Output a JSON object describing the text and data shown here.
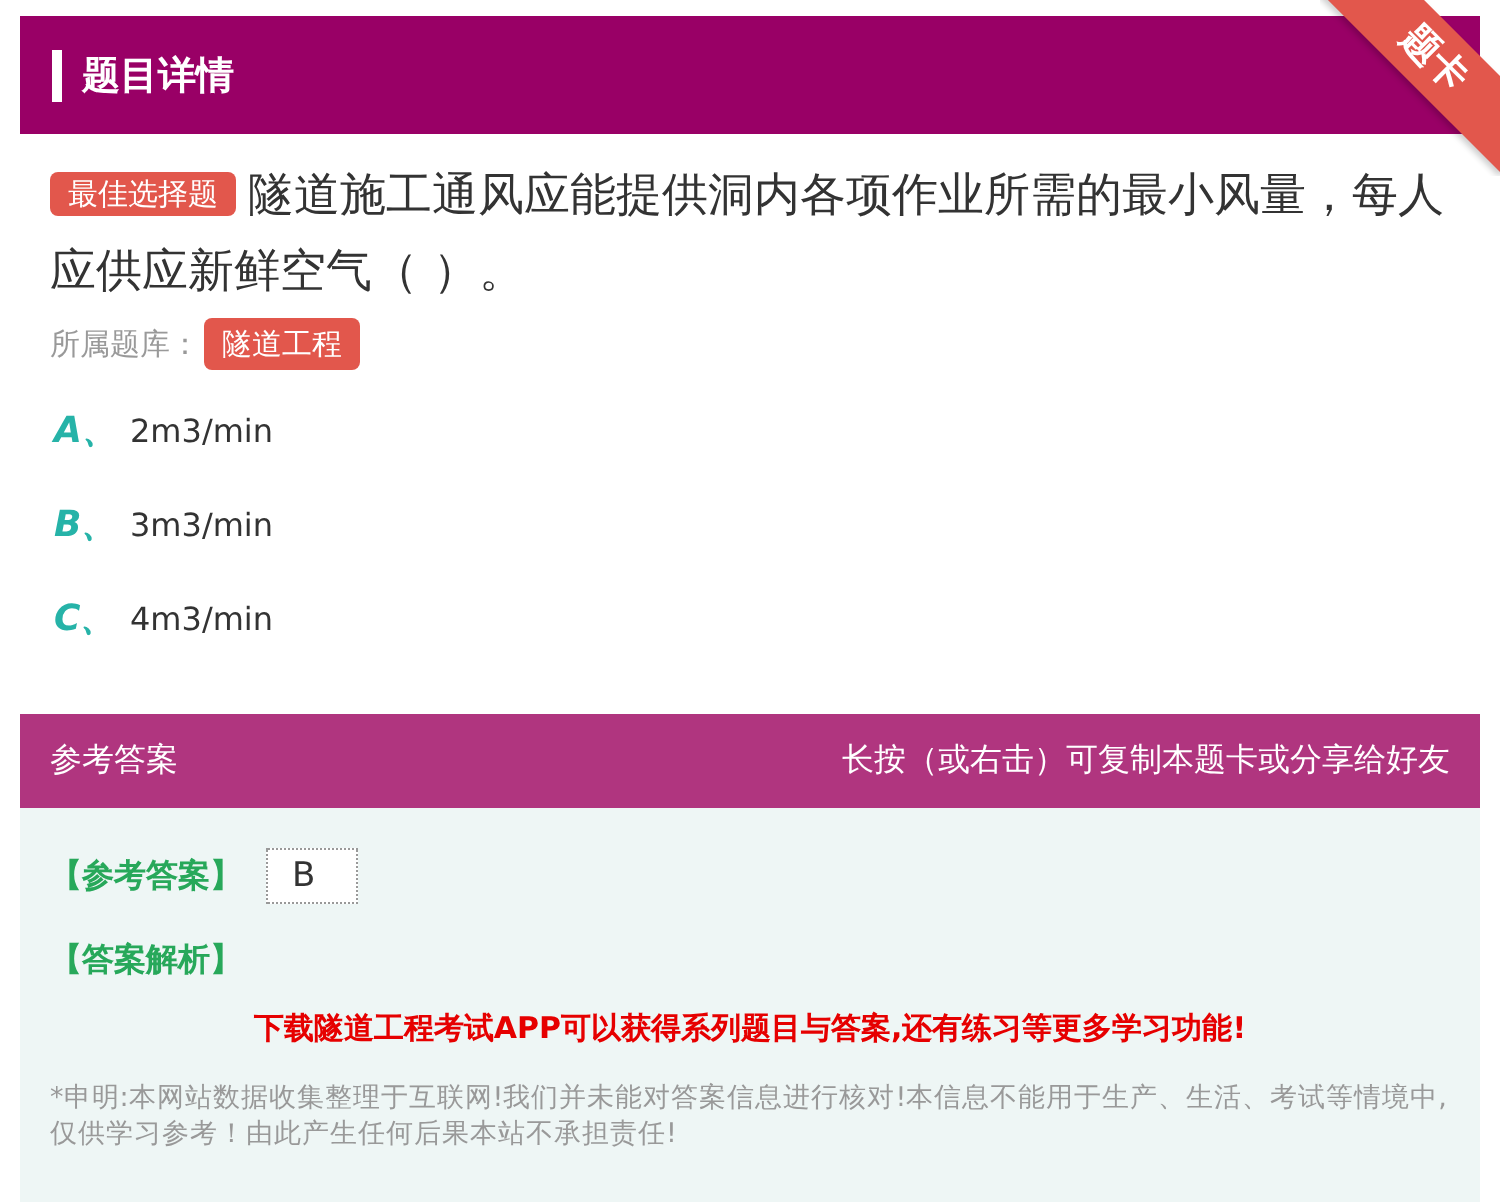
{
  "header": {
    "title": "题目详情",
    "ribbon": "题卡"
  },
  "question": {
    "type_tag": "最佳选择题",
    "text": "隧道施工通风应能提供洞内各项作业所需的最小风量，每人应供应新鲜空气（ ）。",
    "bank_label": "所属题库：",
    "bank_tag": "隧道工程"
  },
  "options": [
    {
      "letter": "A、",
      "text": "2m3/min"
    },
    {
      "letter": "B、",
      "text": "3m3/min"
    },
    {
      "letter": "C、",
      "text": "4m3/min"
    }
  ],
  "answer_bar": {
    "title": "参考答案",
    "hint": "长按（或右击）可复制本题卡或分享给好友"
  },
  "answer": {
    "label": "【参考答案】",
    "value": "B",
    "analysis_label": "【答案解析】",
    "promo": "下载隧道工程考试APP可以获得系列题目与答案,还有练习等更多学习功能!",
    "disclaimer": "*申明:本网站数据收集整理于互联网!我们并未能对答案信息进行核对!本信息不能用于生产、生活、考试等情境中,仅供学习参考！由此产生任何后果本站不承担责任!"
  }
}
